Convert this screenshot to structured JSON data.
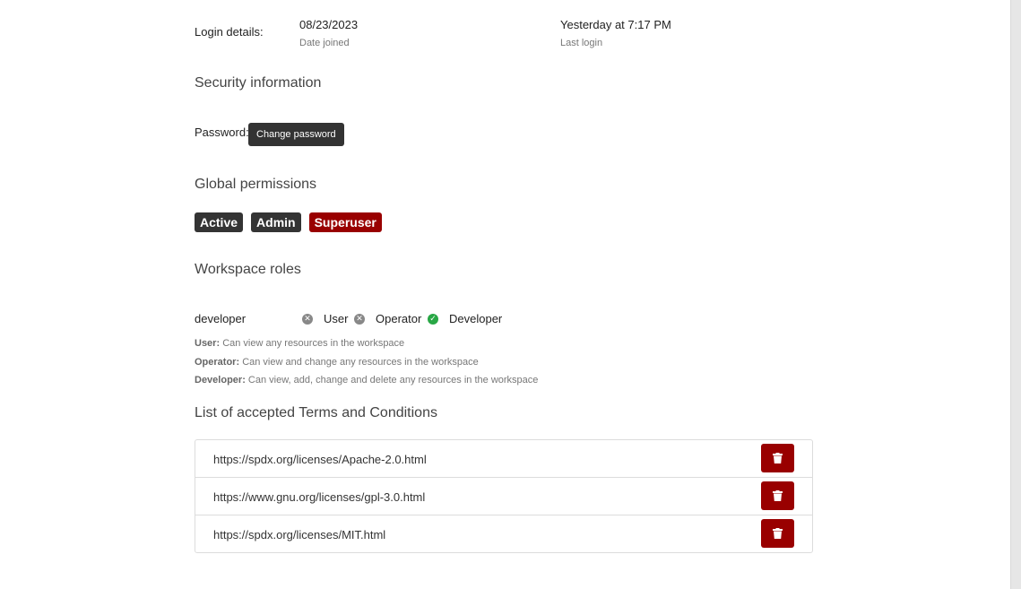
{
  "login": {
    "label": "Login details:",
    "date_joined_value": "08/23/2023",
    "date_joined_label": "Date joined",
    "last_login_value": "Yesterday at 7:17 PM",
    "last_login_label": "Last login"
  },
  "security": {
    "title": "Security information",
    "password_label": "Password:",
    "change_password_label": "Change password"
  },
  "permissions": {
    "title": "Global permissions",
    "badges": [
      {
        "label": "Active",
        "color": "#343434"
      },
      {
        "label": "Admin",
        "color": "#343434"
      },
      {
        "label": "Superuser",
        "color": "#990000"
      }
    ]
  },
  "workspace_roles": {
    "title": "Workspace roles",
    "workspace": "developer",
    "roles": [
      {
        "label": "User",
        "granted": false,
        "icon": "x-circle-icon"
      },
      {
        "label": "Operator",
        "granted": false,
        "icon": "x-circle-icon"
      },
      {
        "label": "Developer",
        "granted": true,
        "icon": "check-circle-icon"
      }
    ],
    "descriptions": [
      {
        "name": "User:",
        "text": "Can view any resources in the workspace"
      },
      {
        "name": "Operator:",
        "text": "Can view and change any resources in the workspace"
      },
      {
        "name": "Developer:",
        "text": "Can view, add, change and delete any resources in the workspace"
      }
    ]
  },
  "terms": {
    "title": "List of accepted Terms and Conditions",
    "items": [
      {
        "url": "https://spdx.org/licenses/Apache-2.0.html",
        "action_icon": "trash-icon"
      },
      {
        "url": "https://www.gnu.org/licenses/gpl-3.0.html",
        "action_icon": "trash-icon"
      },
      {
        "url": "https://spdx.org/licenses/MIT.html",
        "action_icon": "trash-icon"
      }
    ]
  },
  "colors": {
    "danger": "#990000",
    "success": "#28a745",
    "dark": "#343434"
  }
}
